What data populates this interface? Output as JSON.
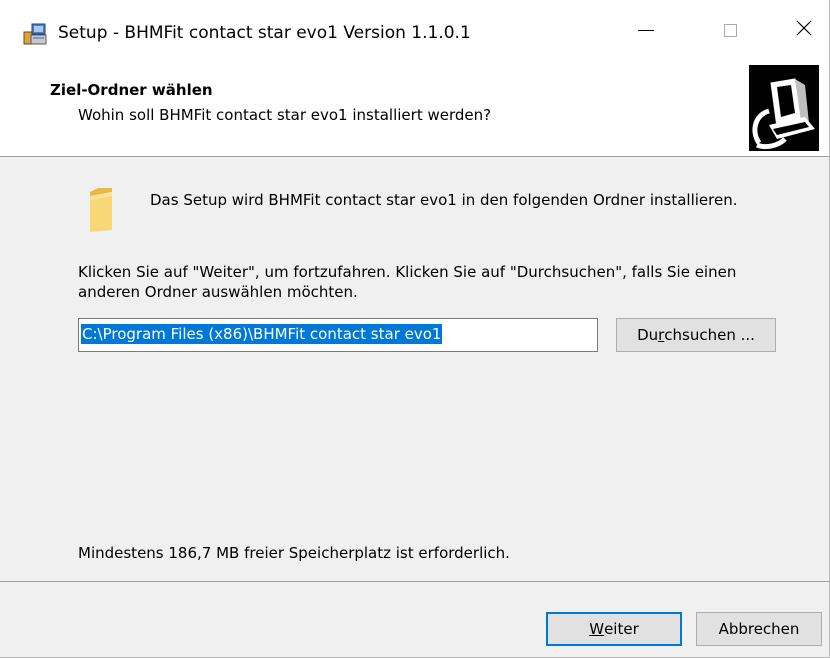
{
  "window": {
    "title": "Setup - BHMFit contact star evo1 Version 1.1.0.1"
  },
  "header": {
    "title": "Ziel-Ordner wählen",
    "subtitle": "Wohin soll BHMFit contact star evo1 installiert werden?"
  },
  "body": {
    "intro": "Das Setup wird BHMFit contact star evo1 in den folgenden Ordner installieren.",
    "instruction": "Klicken Sie auf \"Weiter\", um fortzufahren. Klicken Sie auf \"Durchsuchen\", falls Sie einen anderen Ordner auswählen möchten.",
    "path_value": "C:\\Program Files (x86)\\BHMFit contact star evo1",
    "browse_label_pre": "Du",
    "browse_label_accel": "r",
    "browse_label_post": "chsuchen ...",
    "space_required": "Mindestens 186,7 MB freier Speicherplatz ist erforderlich."
  },
  "footer": {
    "next_label_accel": "W",
    "next_label_post": "eiter",
    "cancel_label": "Abbrechen"
  },
  "icons": {
    "app": "setup-app-icon",
    "folder": "folder-icon",
    "wizard": "computer-install-icon",
    "minimize": "minimize-icon",
    "maximize": "maximize-icon",
    "close": "close-icon"
  },
  "colors": {
    "selection": "#0078d7",
    "window_bg": "#f0f0f0",
    "header_bg": "#ffffff",
    "default_button_border": "#0078d7"
  }
}
